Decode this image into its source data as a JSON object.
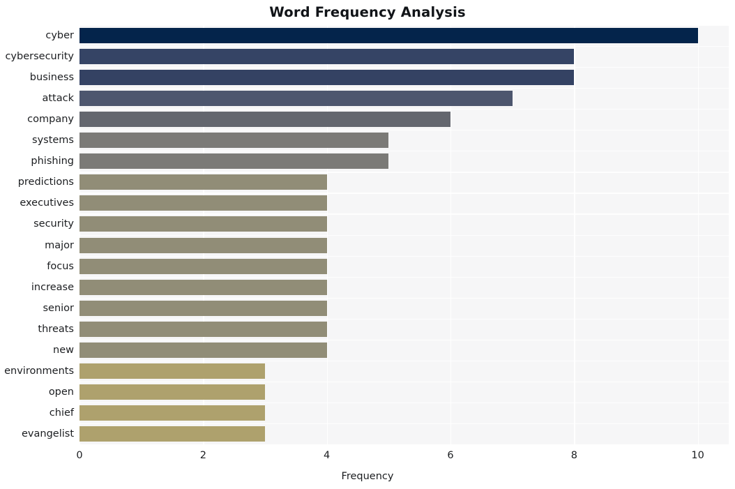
{
  "chart_data": {
    "type": "bar",
    "orientation": "horizontal",
    "title": "Word Frequency Analysis",
    "xlabel": "Frequency",
    "ylabel": "",
    "xlim": [
      0,
      10.5
    ],
    "xticks": [
      0,
      2,
      4,
      6,
      8,
      10
    ],
    "xtick_labels": [
      "0",
      "2",
      "4",
      "6",
      "8",
      "10"
    ],
    "grid": true,
    "legend": "none",
    "categories": [
      "cyber",
      "cybersecurity",
      "business",
      "attack",
      "company",
      "systems",
      "phishing",
      "predictions",
      "executives",
      "security",
      "major",
      "focus",
      "increase",
      "senior",
      "threats",
      "new",
      "environments",
      "open",
      "chief",
      "evangelist"
    ],
    "values": [
      10,
      8,
      8,
      7,
      6,
      5,
      5,
      4,
      4,
      4,
      4,
      4,
      4,
      4,
      4,
      4,
      3,
      3,
      3,
      3
    ],
    "bar_colors": [
      "#04244b",
      "#354465",
      "#344263",
      "#4d566e",
      "#63666e",
      "#7b7a77",
      "#7b7a77",
      "#918d77",
      "#918d77",
      "#918d77",
      "#918d77",
      "#918d77",
      "#918d77",
      "#918d77",
      "#918d77",
      "#918d77",
      "#aea16d",
      "#aea16d",
      "#aea16d",
      "#aea16d"
    ],
    "plot_background": "#f6f6f7",
    "gridline_color": "#ffffff",
    "figure_background": "#ffffff"
  }
}
